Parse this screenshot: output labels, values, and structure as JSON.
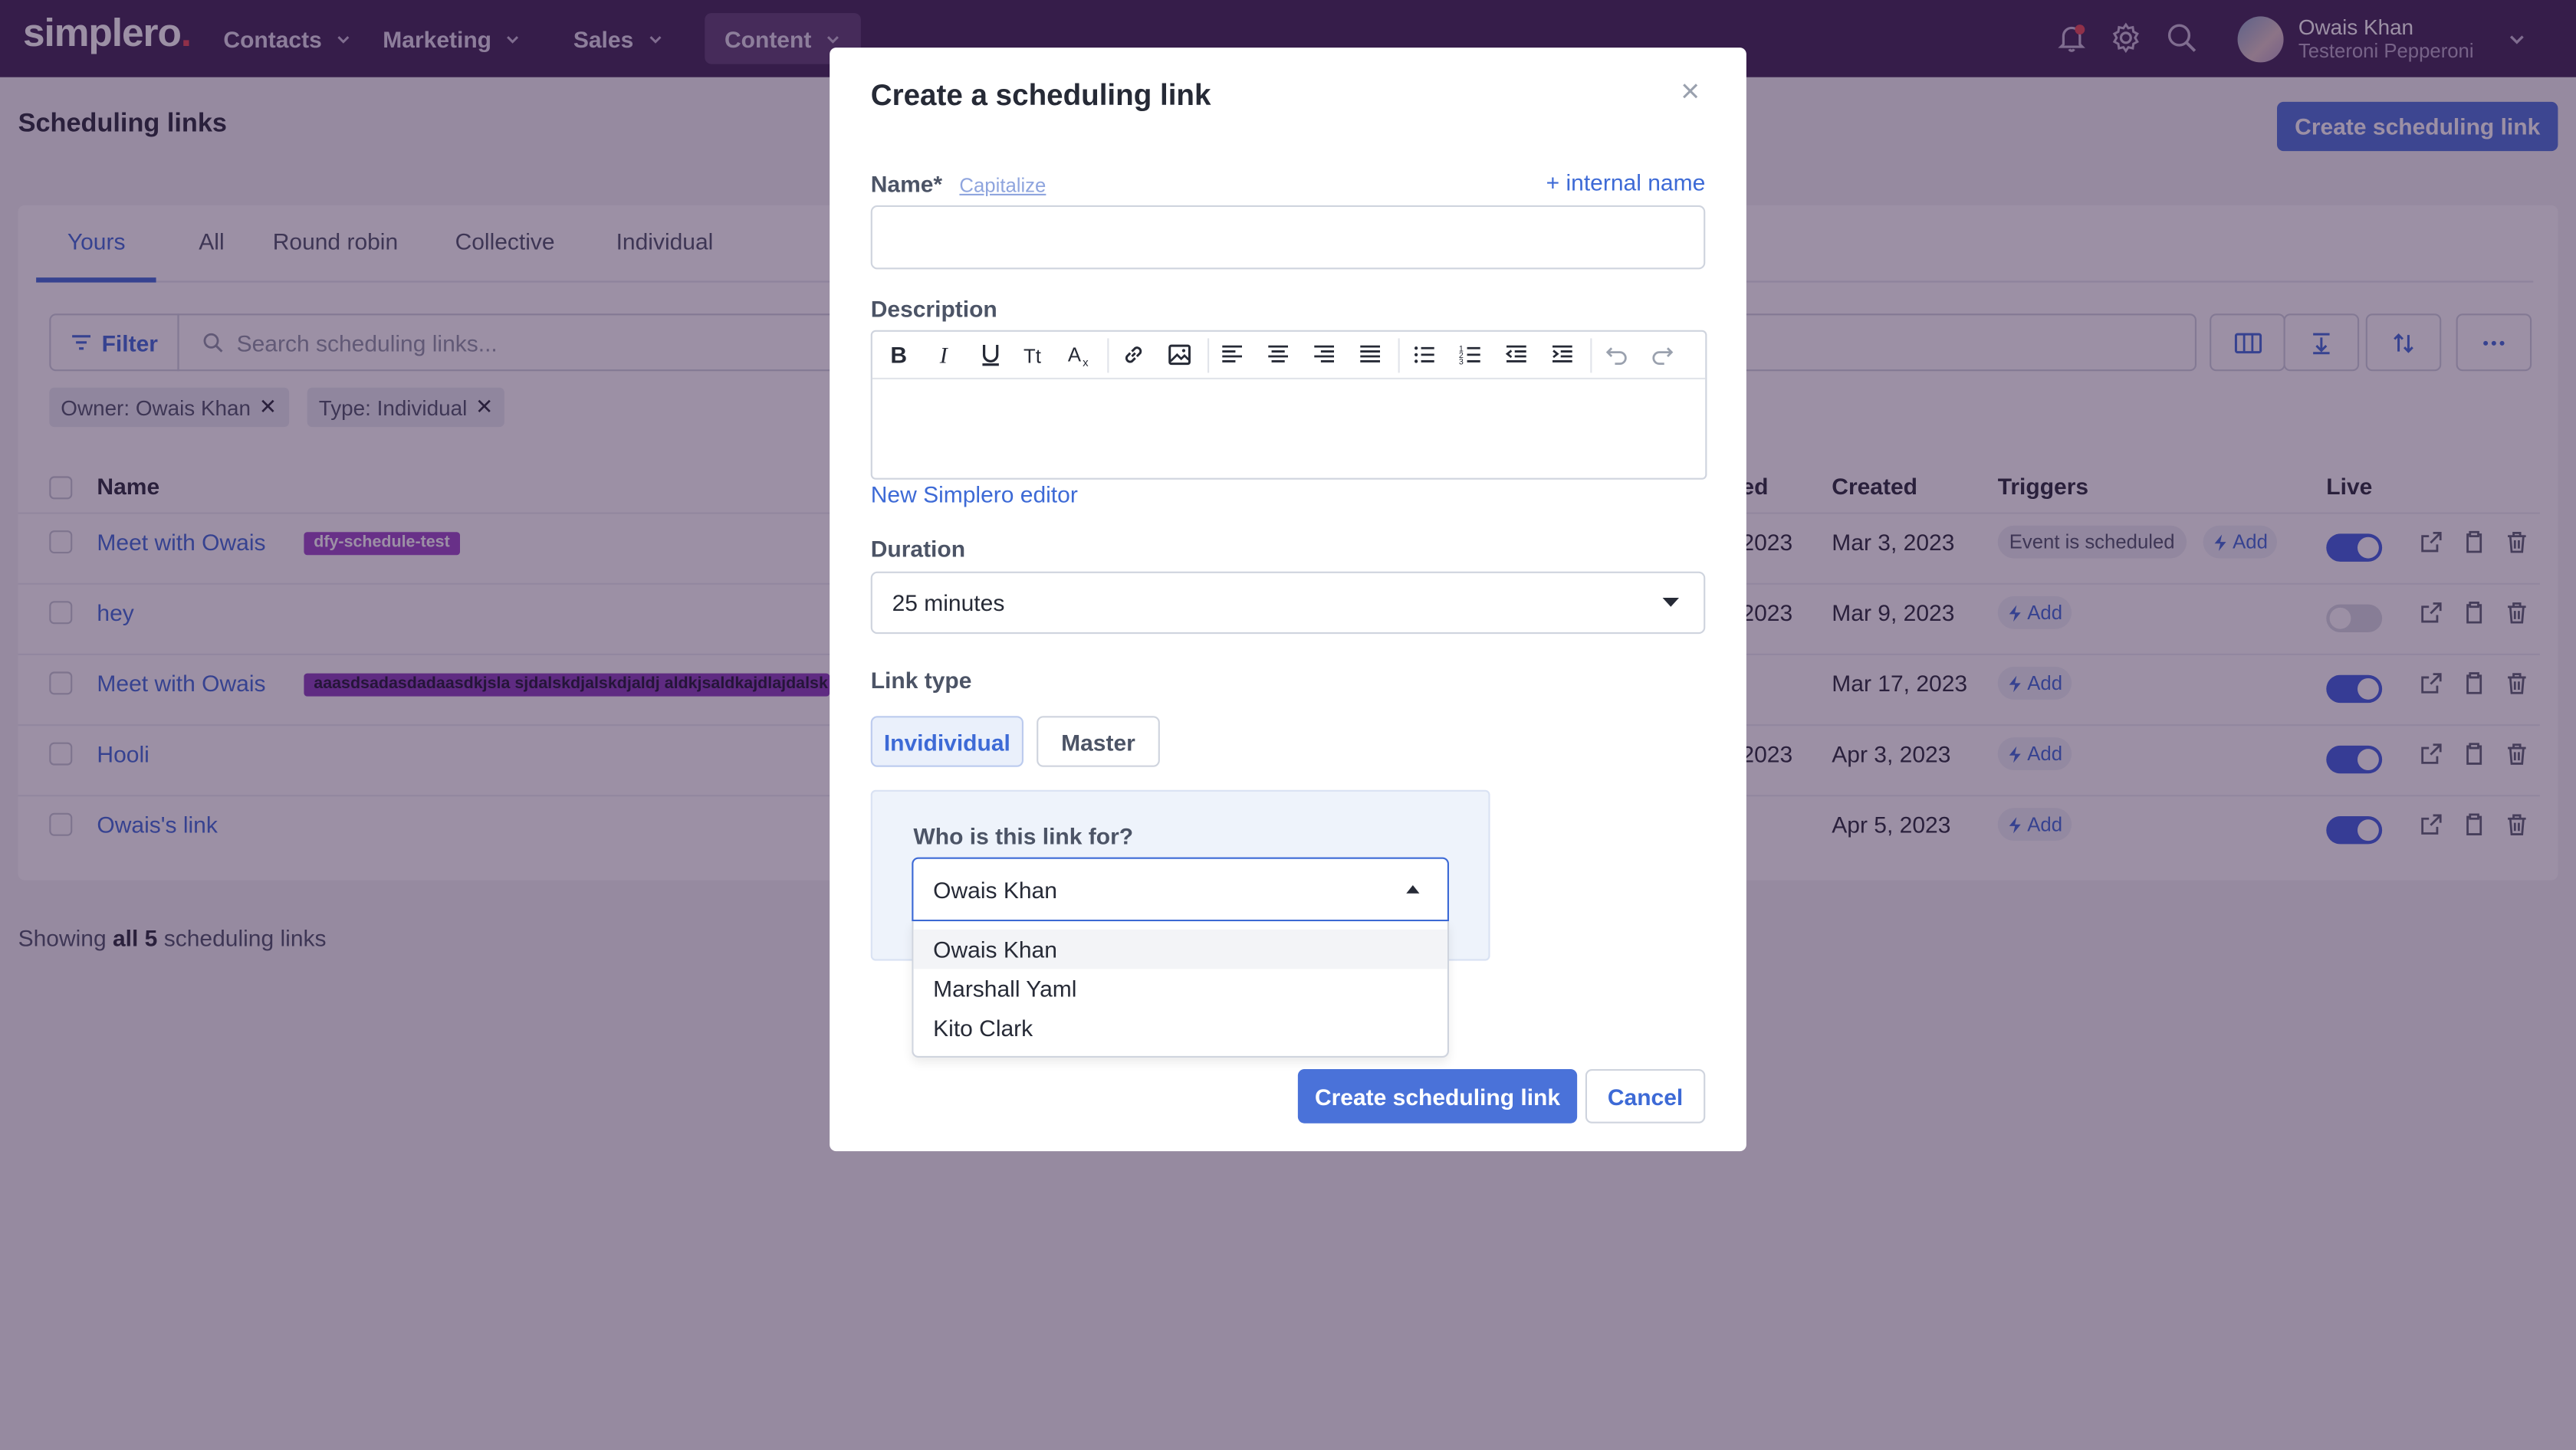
{
  "navbar": {
    "logo_text": "simplero",
    "logo_dot": ".",
    "items": [
      {
        "label": "Contacts"
      },
      {
        "label": "Marketing"
      },
      {
        "label": "Sales"
      },
      {
        "label": "Content"
      }
    ],
    "user": {
      "name": "Owais Khan",
      "org": "Testeroni Pepperoni"
    },
    "icons": [
      "bell-icon",
      "gear-icon",
      "search-icon"
    ]
  },
  "page": {
    "title": "Scheduling links",
    "create_button": "Create scheduling link"
  },
  "tabs": [
    "Yours",
    "All",
    "Round robin",
    "Collective",
    "Individual"
  ],
  "toolbar": {
    "filter_label": "Filter",
    "search_placeholder": "Search scheduling links..."
  },
  "filters": [
    {
      "label": "Owner: Owais Khan"
    },
    {
      "label": "Type: Individual"
    }
  ],
  "table": {
    "headers": {
      "name": "Name",
      "updated": "ed",
      "created": "Created",
      "triggers": "Triggers",
      "live": "Live"
    },
    "rows": [
      {
        "name": "Meet with Owais",
        "tag": "dfy-schedule-test",
        "updated": "2023",
        "created": "Mar 3, 2023",
        "event": "Event is scheduled",
        "add": "Add",
        "live": true
      },
      {
        "name": "hey",
        "tag": "",
        "updated": "2023",
        "created": "Mar 9, 2023",
        "event": "",
        "add": "Add",
        "live": false
      },
      {
        "name": "Meet with Owais",
        "tag": "aaasdsadasdadaasdkjsla sjdalskdjalskdjaldj aldkjsaldkajdlajdalsk",
        "updated": "",
        "created": "Mar 17, 2023",
        "event": "",
        "add": "Add",
        "live": true
      },
      {
        "name": "Hooli",
        "tag": "",
        "updated": "2023",
        "created": "Apr 3, 2023",
        "event": "",
        "add": "Add",
        "live": true
      },
      {
        "name": "Owais's link",
        "tag": "",
        "updated": "",
        "created": "Apr 5, 2023",
        "event": "",
        "add": "Add",
        "live": true
      }
    ]
  },
  "footer": {
    "prefix": "Showing ",
    "bold": "all 5",
    "suffix": " scheduling links"
  },
  "modal": {
    "title": "Create a scheduling link",
    "close": "×",
    "name_label": "Name*",
    "capitalize": "Capitalize",
    "internal_name": "+ internal name",
    "description_label": "Description",
    "editor_link": "New Simplero editor",
    "duration_label": "Duration",
    "duration_value": "25 minutes",
    "link_type_label": "Link type",
    "link_types": [
      "Invidividual",
      "Master"
    ],
    "who_label": "Who is this link for?",
    "who_value": "Owais Khan",
    "who_options": [
      "Owais Khan",
      "Marshall Yaml",
      "Kito Clark"
    ],
    "submit": "Create scheduling link",
    "cancel": "Cancel"
  }
}
